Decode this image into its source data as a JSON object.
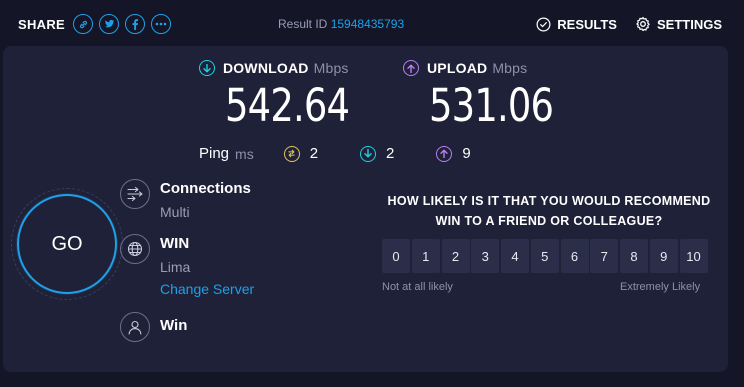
{
  "header": {
    "share_label": "SHARE",
    "share_icons": [
      "link-icon",
      "twitter-icon",
      "facebook-icon",
      "more-icon"
    ],
    "result_id_label": "Result ID",
    "result_id_value": "15948435793",
    "results_label": "RESULTS",
    "settings_label": "SETTINGS"
  },
  "download": {
    "label": "DOWNLOAD",
    "unit": "Mbps",
    "value": "542.64",
    "color": "#1fd1e0"
  },
  "upload": {
    "label": "UPLOAD",
    "unit": "Mbps",
    "value": "531.06",
    "color": "#bb7ff2"
  },
  "ping": {
    "label": "Ping",
    "unit": "ms",
    "idle": {
      "value": "2",
      "color": "#e3c65b"
    },
    "download": {
      "value": "2",
      "color": "#1fd1e0"
    },
    "upload": {
      "value": "9",
      "color": "#bb7ff2"
    }
  },
  "go_button": {
    "label": "GO",
    "accent": "#1fa0e8"
  },
  "connections": {
    "title": "Connections",
    "value": "Multi"
  },
  "server": {
    "title": "WIN",
    "location": "Lima",
    "change_label": "Change Server"
  },
  "provider": {
    "title": "Win"
  },
  "survey": {
    "question": "HOW LIKELY IS IT THAT YOU WOULD RECOMMEND WIN TO A FRIEND OR COLLEAGUE?",
    "options": [
      "0",
      "1",
      "2",
      "3",
      "4",
      "5",
      "6",
      "7",
      "8",
      "9",
      "10"
    ],
    "low_label": "Not at all likely",
    "high_label": "Extremely Likely"
  }
}
